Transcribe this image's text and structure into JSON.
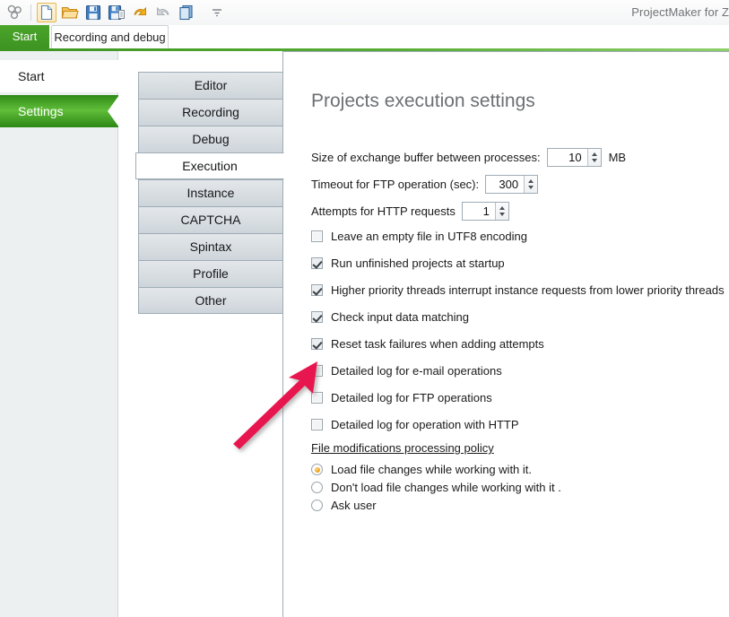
{
  "window": {
    "title": "ProjectMaker for Z"
  },
  "toolbar": {
    "icons": [
      {
        "name": "app-logo-icon",
        "label": "ProjectMaker"
      },
      {
        "name": "new-file-icon",
        "label": "New"
      },
      {
        "name": "open-folder-icon",
        "label": "Open"
      },
      {
        "name": "save-icon",
        "label": "Save"
      },
      {
        "name": "save-as-icon",
        "label": "Save as"
      },
      {
        "name": "undo-icon",
        "label": "Undo"
      },
      {
        "name": "redo-icon",
        "label": "Redo"
      },
      {
        "name": "copy-icon",
        "label": "Copy"
      },
      {
        "name": "toolbar-overflow-icon",
        "label": "More"
      }
    ]
  },
  "tabs": [
    {
      "label": "Start",
      "active": true
    },
    {
      "label": "Recording and debug",
      "active": false
    }
  ],
  "sidebar": {
    "items": [
      {
        "label": "Start",
        "selected": false
      },
      {
        "label": "Settings",
        "selected": true
      }
    ]
  },
  "categories": [
    {
      "label": "Editor",
      "selected": false
    },
    {
      "label": "Recording",
      "selected": false
    },
    {
      "label": "Debug",
      "selected": false
    },
    {
      "label": "Execution",
      "selected": true
    },
    {
      "label": "Instance",
      "selected": false
    },
    {
      "label": "CAPTCHA",
      "selected": false
    },
    {
      "label": "Spintax",
      "selected": false
    },
    {
      "label": "Profile",
      "selected": false
    },
    {
      "label": "Other",
      "selected": false
    }
  ],
  "panel": {
    "title": "Projects execution settings",
    "fields": [
      {
        "label": "Size of exchange buffer between processes:",
        "value": "10",
        "unit": "MB"
      },
      {
        "label": "Timeout for FTP operation (sec):",
        "value": "300",
        "unit": ""
      },
      {
        "label": "Attempts for HTTP requests",
        "value": "1",
        "unit": ""
      }
    ],
    "checkboxes": [
      {
        "label": "Leave an empty file in UTF8 encoding",
        "checked": false
      },
      {
        "label": "Run unfinished projects at startup",
        "checked": true
      },
      {
        "label": "Higher priority threads interrupt instance requests from lower priority threads",
        "checked": true
      },
      {
        "label": "Check input data matching",
        "checked": true
      },
      {
        "label": "Reset task failures when adding attempts",
        "checked": true
      },
      {
        "label": "Detailed log for e-mail operations",
        "checked": false
      },
      {
        "label": "Detailed log for FTP operations",
        "checked": false
      },
      {
        "label": "Detailed log for operation with HTTP",
        "checked": false
      }
    ],
    "group_header": "File modifications processing policy",
    "radios": [
      {
        "label": "Load file changes while working with it.",
        "selected": true
      },
      {
        "label": "Don't load file changes while working with it .",
        "selected": false
      },
      {
        "label": "Ask user",
        "selected": false
      }
    ]
  },
  "annotation": {
    "name": "pointer-arrow",
    "color": "#e8184f",
    "points_at": "Detailed log for e-mail operations"
  }
}
